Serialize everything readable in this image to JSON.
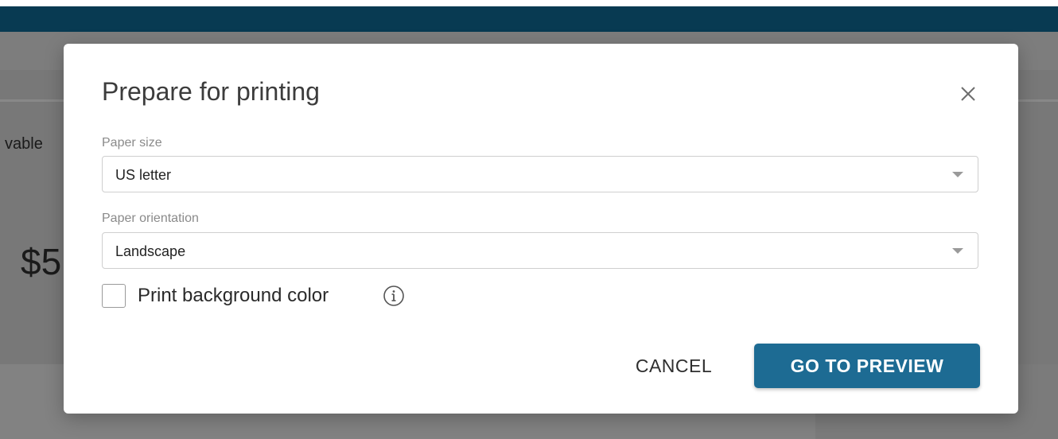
{
  "background": {
    "partial_label": "vable",
    "partial_value": "$5"
  },
  "dialog": {
    "title": "Prepare for printing",
    "close_icon": "close-icon",
    "paper_size": {
      "label": "Paper size",
      "value": "US letter"
    },
    "paper_orientation": {
      "label": "Paper orientation",
      "value": "Landscape"
    },
    "print_background": {
      "label": "Print background color",
      "checked": false,
      "info_icon": "info-icon"
    },
    "buttons": {
      "cancel": "CANCEL",
      "preview": "GO TO PREVIEW"
    }
  },
  "colors": {
    "navbar": "#083a52",
    "primary_button": "#1d6b93",
    "backdrop": "#7d7d7d"
  }
}
